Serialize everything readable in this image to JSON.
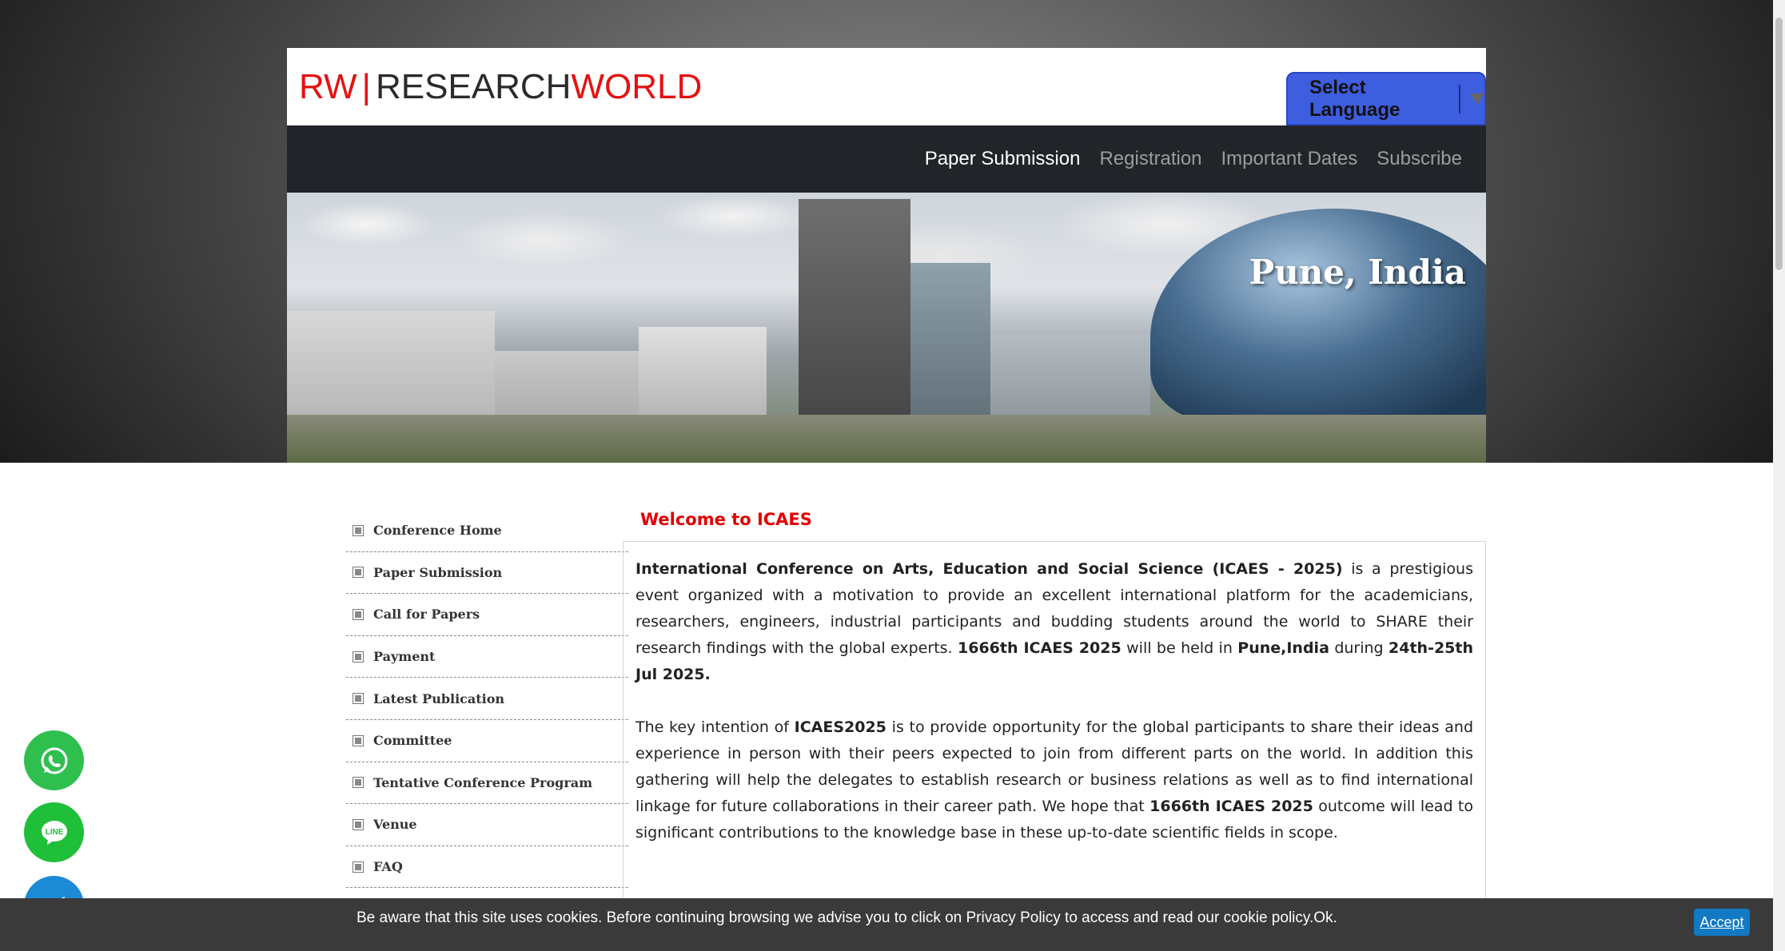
{
  "header": {
    "logo": {
      "rw": "RW",
      "bar": "|",
      "research": "RESEARCH",
      "world": "WORLD"
    },
    "language_button": "Select Language"
  },
  "nav": {
    "items": [
      {
        "label": "Paper Submission",
        "active": true
      },
      {
        "label": "Registration",
        "active": false
      },
      {
        "label": "Important Dates",
        "active": false
      },
      {
        "label": "Subscribe",
        "active": false
      }
    ]
  },
  "banner": {
    "title": "Pune, India"
  },
  "sidebar": {
    "items": [
      {
        "label": "Conference Home"
      },
      {
        "label": "Paper Submission"
      },
      {
        "label": "Call for Papers"
      },
      {
        "label": "Payment"
      },
      {
        "label": "Latest Publication"
      },
      {
        "label": "Committee"
      },
      {
        "label": "Tentative Conference Program"
      },
      {
        "label": "Venue"
      },
      {
        "label": "FAQ"
      }
    ]
  },
  "main": {
    "title": "Welcome to ICAES",
    "p1": {
      "b1": "International Conference on Arts, Education and Social Science (ICAES - 2025)",
      "t1": " is a prestigious event organized with a motivation to provide an excellent international platform for the academicians, researchers, engineers, industrial participants and budding students around the world to SHARE their research findings with the global experts. ",
      "b2": "1666th ICAES 2025",
      "t2": " will be held in  ",
      "b3": "Pune,India",
      "t3": " during ",
      "b4": "24th-25th Jul 2025."
    },
    "p2": {
      "t1": "The key intention of  ",
      "b1": "ICAES2025",
      "t2": " is to provide opportunity for the global participants to share their ideas and experience in person with their peers expected to join from different parts on the world. In addition this gathering will help the delegates to establish research or business relations as well as to find international linkage for future collaborations in their career path. We hope that ",
      "b2": "1666th ICAES 2025",
      "t3": " outcome will lead to significant contributions to the knowledge base in these up-to-date scientific fields in scope."
    }
  },
  "floating": {
    "whatsapp_icon": "whatsapp-icon",
    "line_icon": "line-icon",
    "line_text": "LINE",
    "telegram_icon": "telegram-icon"
  },
  "cookie": {
    "text": "Be aware that this site uses cookies. Before continuing browsing we advise you to click on Privacy Policy to access and read our cookie policy.Ok.",
    "accept": "Accept"
  },
  "colors": {
    "accent": "#e31212",
    "navbar": "#212529",
    "language_button": "#3e5ee0",
    "cookie_bar": "#3a3a3a"
  }
}
